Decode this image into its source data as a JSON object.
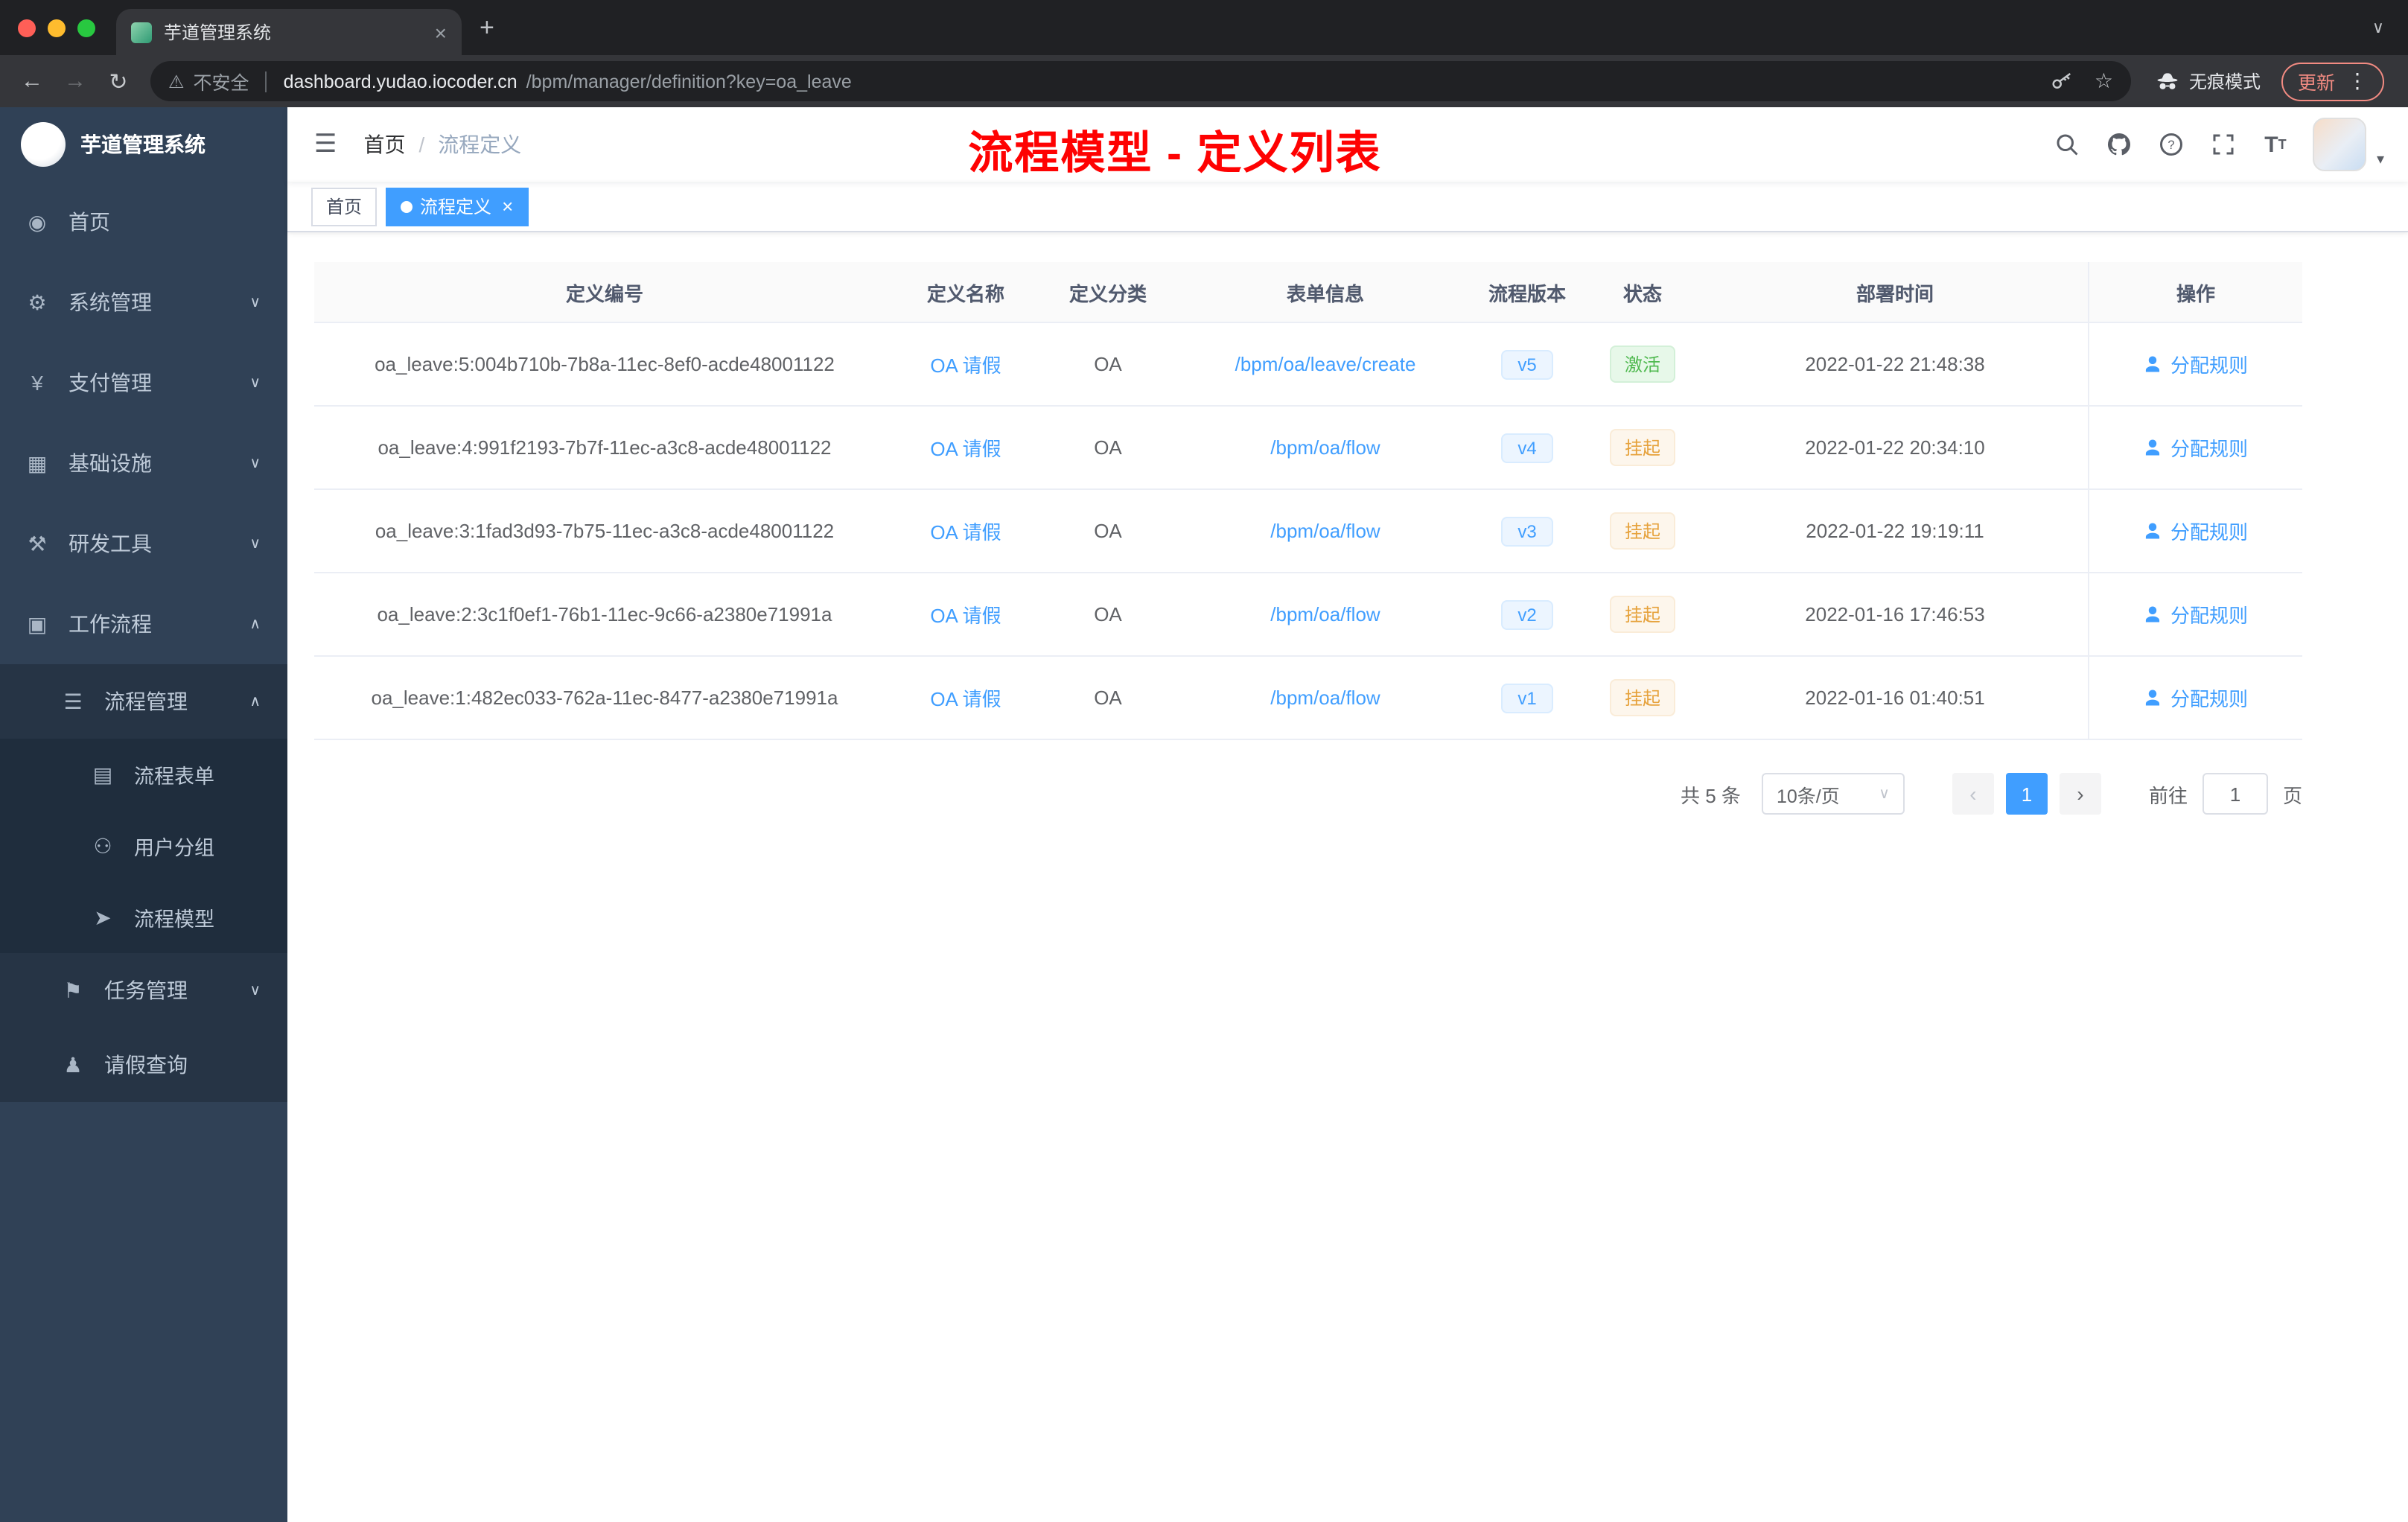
{
  "colors": {
    "accent": "#409eff",
    "annotation": "#ff0000",
    "sidebar_bg": "#304156",
    "status_active": "#4fb94f",
    "status_suspend": "#e6a23c"
  },
  "browser": {
    "tab_title": "芋道管理系统",
    "security_label": "不安全",
    "url_domain": "dashboard.yudao.iocoder.cn",
    "url_path": "/bpm/manager/definition?key=oa_leave",
    "incognito_label": "无痕模式",
    "update_label": "更新"
  },
  "sidebar": {
    "title": "芋道管理系统",
    "items": [
      {
        "key": "home",
        "label": "首页",
        "icon": "dashboard-icon",
        "level": 0
      },
      {
        "key": "system",
        "label": "系统管理",
        "icon": "gear-icon",
        "level": 0,
        "arrow": "down"
      },
      {
        "key": "payment",
        "label": "支付管理",
        "icon": "yen-icon",
        "level": 0,
        "arrow": "down"
      },
      {
        "key": "infrastructure",
        "label": "基础设施",
        "icon": "infra-icon",
        "level": 0,
        "arrow": "down"
      },
      {
        "key": "devtools",
        "label": "研发工具",
        "icon": "tools-icon",
        "level": 0,
        "arrow": "down"
      },
      {
        "key": "workflow",
        "label": "工作流程",
        "icon": "workflow-icon",
        "level": 0,
        "arrow": "up"
      },
      {
        "key": "process-manage",
        "label": "流程管理",
        "icon": "list-icon",
        "level": 1,
        "arrow": "up"
      },
      {
        "key": "process-form",
        "label": "流程表单",
        "icon": "form-icon",
        "level": 2
      },
      {
        "key": "user-group",
        "label": "用户分组",
        "icon": "user-group-icon",
        "level": 2
      },
      {
        "key": "process-model",
        "label": "流程模型",
        "icon": "send-icon",
        "level": 2
      },
      {
        "key": "task-manage",
        "label": "任务管理",
        "icon": "task-icon",
        "level": 1,
        "arrow": "down"
      },
      {
        "key": "leave-query",
        "label": "请假查询",
        "icon": "person-icon",
        "level": 1
      }
    ]
  },
  "header": {
    "breadcrumb": [
      "首页",
      "流程定义"
    ],
    "separator": "/",
    "annotation": "流程模型 - 定义列表"
  },
  "tags": [
    {
      "label": "首页",
      "active": false,
      "closable": false
    },
    {
      "label": "流程定义",
      "active": true,
      "closable": true
    }
  ],
  "table": {
    "columns": [
      "定义编号",
      "定义名称",
      "定义分类",
      "表单信息",
      "流程版本",
      "状态",
      "部署时间",
      "操作"
    ],
    "rows": [
      {
        "id": "oa_leave:5:004b710b-7b8a-11ec-8ef0-acde48001122",
        "name": "OA 请假",
        "category": "OA",
        "form": "/bpm/oa/leave/create",
        "version": "v5",
        "status": "激活",
        "status_type": "active",
        "time": "2022-01-22 21:48:38",
        "action": "分配规则"
      },
      {
        "id": "oa_leave:4:991f2193-7b7f-11ec-a3c8-acde48001122",
        "name": "OA 请假",
        "category": "OA",
        "form": "/bpm/oa/flow",
        "version": "v4",
        "status": "挂起",
        "status_type": "suspend",
        "time": "2022-01-22 20:34:10",
        "action": "分配规则"
      },
      {
        "id": "oa_leave:3:1fad3d93-7b75-11ec-a3c8-acde48001122",
        "name": "OA 请假",
        "category": "OA",
        "form": "/bpm/oa/flow",
        "version": "v3",
        "status": "挂起",
        "status_type": "suspend",
        "time": "2022-01-22 19:19:11",
        "action": "分配规则"
      },
      {
        "id": "oa_leave:2:3c1f0ef1-76b1-11ec-9c66-a2380e71991a",
        "name": "OA 请假",
        "category": "OA",
        "form": "/bpm/oa/flow",
        "version": "v2",
        "status": "挂起",
        "status_type": "suspend",
        "time": "2022-01-16 17:46:53",
        "action": "分配规则"
      },
      {
        "id": "oa_leave:1:482ec033-762a-11ec-8477-a2380e71991a",
        "name": "OA 请假",
        "category": "OA",
        "form": "/bpm/oa/flow",
        "version": "v1",
        "status": "挂起",
        "status_type": "suspend",
        "time": "2022-01-16 01:40:51",
        "action": "分配规则"
      }
    ]
  },
  "pagination": {
    "total": "共 5 条",
    "page_size": "10条/页",
    "current": "1",
    "goto": "前往",
    "goto_value": "1",
    "unit": "页"
  },
  "icons": {
    "dashboard-icon": "◉",
    "gear-icon": "⚙",
    "yen-icon": "¥",
    "infra-icon": "▦",
    "tools-icon": "⚒",
    "workflow-icon": "▣",
    "list-icon": "☰",
    "form-icon": "▤",
    "user-group-icon": "⚇",
    "send-icon": "➤",
    "task-icon": "⚑",
    "person-icon": "♟",
    "hamburger-icon": "☰",
    "dots-icon": "⋮",
    "close-icon": "×",
    "plus-icon": "+",
    "chevron-down": "∨",
    "chevron-up": "∧",
    "warning-icon": "⚠",
    "star-icon": "☆",
    "back-icon": "←",
    "forward-icon": "→",
    "reload-icon": "↻",
    "caret-down": "▾",
    "prev-icon": "‹",
    "next-icon": "›"
  }
}
